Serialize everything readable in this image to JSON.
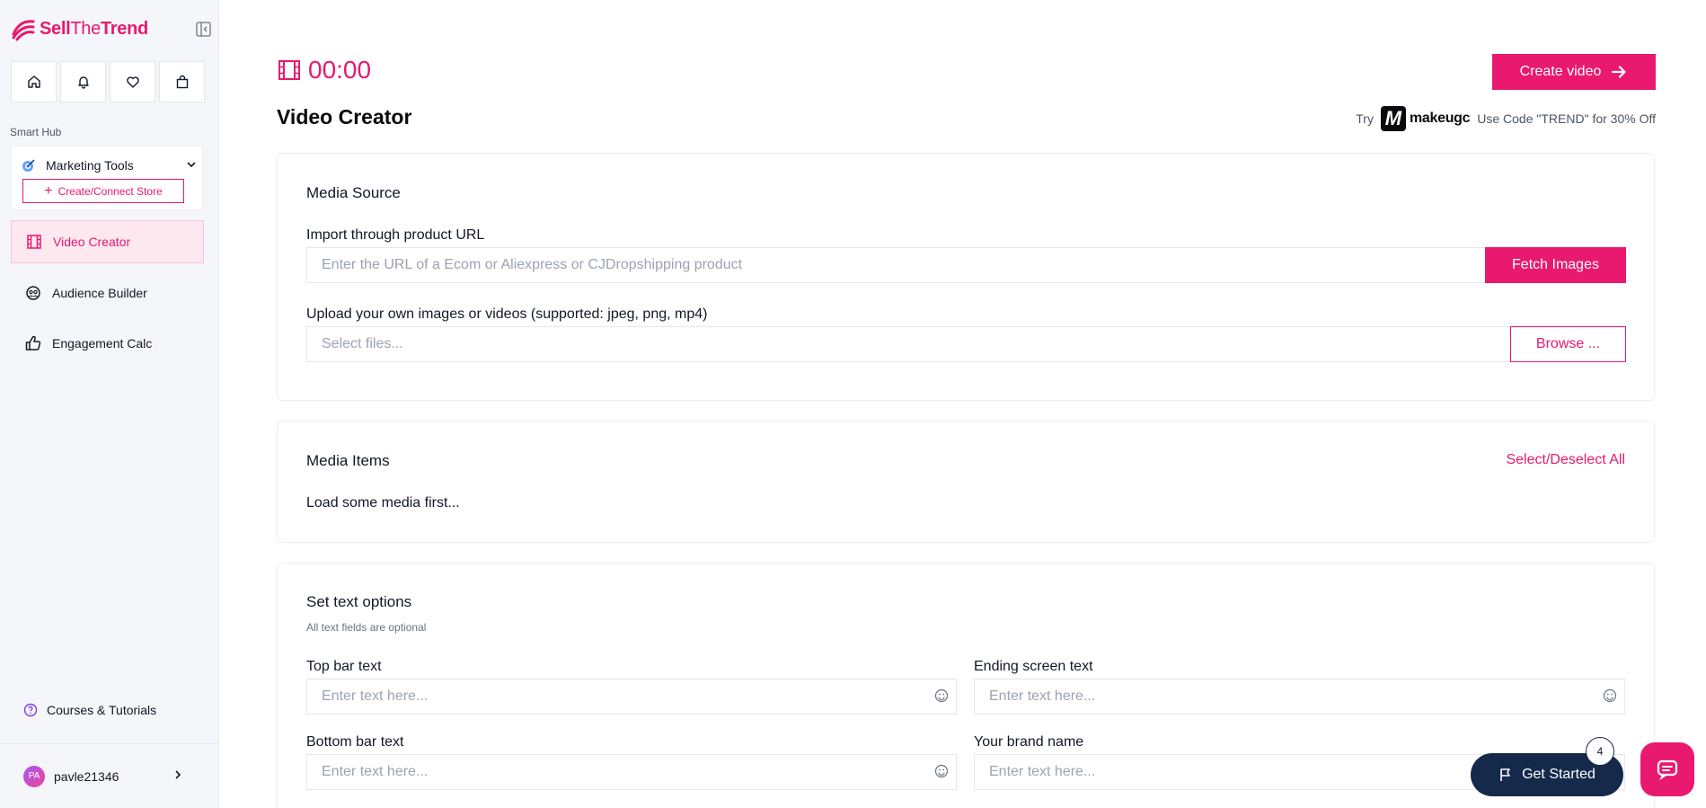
{
  "brand": {
    "name_bold": "Sell",
    "name_thin": "The",
    "name_end": "Trend",
    "accent": "#e8196f"
  },
  "sidebar": {
    "section_label": "Smart Hub",
    "marketing": {
      "label": "Marketing Tools",
      "connect_button": "Create/Connect Store"
    },
    "items": [
      {
        "label": "Video Creator",
        "icon": "film-icon",
        "active": true
      },
      {
        "label": "Audience Builder",
        "icon": "audience-icon",
        "active": false
      },
      {
        "label": "Engagement Calc",
        "icon": "thumbs-up-icon",
        "active": false
      }
    ],
    "courses_label": "Courses & Tutorials",
    "user": {
      "initials": "PA",
      "name": "pavle21346"
    }
  },
  "header": {
    "timer": "00:00",
    "title": "Video Creator",
    "create_button": "Create video",
    "promo": {
      "try": "Try",
      "brand": "makeugc",
      "code_text": "Use Code \"TREND\" for 30% Off"
    }
  },
  "media_source": {
    "title": "Media Source",
    "url_label": "Import through product URL",
    "url_placeholder": "Enter the URL of a Ecom or Aliexpress or CJDropshipping product",
    "fetch_button": "Fetch Images",
    "upload_label": "Upload your own images or videos (supported: jpeg, png, mp4)",
    "upload_placeholder": "Select files...",
    "browse_button": "Browse ..."
  },
  "media_items": {
    "title": "Media Items",
    "select_all": "Select/Deselect All",
    "empty_text": "Load some media first..."
  },
  "text_options": {
    "title": "Set text options",
    "note": "All text fields are optional",
    "fields": [
      {
        "label": "Top bar text",
        "placeholder": "Enter text here..."
      },
      {
        "label": "Ending screen text",
        "placeholder": "Enter text here..."
      },
      {
        "label": "Bottom bar text",
        "placeholder": "Enter text here..."
      },
      {
        "label": "Your brand name",
        "placeholder": "Enter text here..."
      }
    ]
  },
  "widgets": {
    "get_started": "Get Started",
    "badge_count": "4"
  }
}
